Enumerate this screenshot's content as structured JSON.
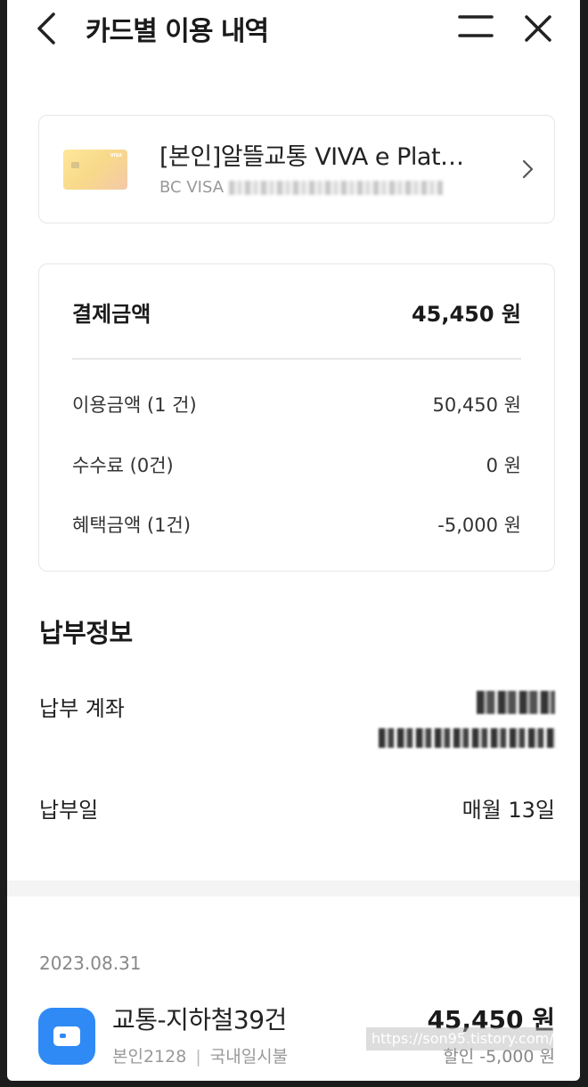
{
  "header": {
    "title": "카드별 이용 내역"
  },
  "card": {
    "name": "[본인]알뜰교통 VIVA e Plat…",
    "number_prefix": "BC VISA"
  },
  "summary": {
    "total_label": "결제금액",
    "total_value": "45,450 원",
    "rows": [
      {
        "label": "이용금액 (1 건)",
        "value": "50,450 원"
      },
      {
        "label": "수수료 (0건)",
        "value": "0 원"
      },
      {
        "label": "혜택금액 (1건)",
        "value": "-5,000 원"
      }
    ]
  },
  "payment_info": {
    "title": "납부정보",
    "account_label": "납부 계좌",
    "day_label": "납부일",
    "day_value": "매월 13일"
  },
  "transactions": {
    "date": "2023.08.31",
    "items": [
      {
        "title": "교통-지하철39건",
        "owner": "본인2128",
        "separator": "|",
        "type": "국내일시불",
        "amount": "45,450 원",
        "discount": "할인 -5,000 원"
      }
    ]
  },
  "watermark": "https://son95.tistory.com/",
  "colors": {
    "accent": "#2f8af5",
    "card_gradient_start": "#ffe79a",
    "card_gradient_end": "#f3c9a9"
  }
}
